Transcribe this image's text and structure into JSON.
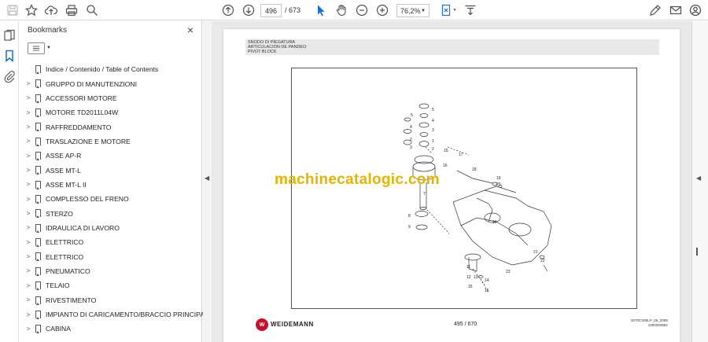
{
  "toolbar": {
    "current_page": "496",
    "total_pages": "/ 673",
    "zoom": "76,2%"
  },
  "bookmarks_panel": {
    "title": "Bookmarks",
    "close": "×",
    "items": [
      {
        "label": "Indice / Contenido / Table of Contents",
        "has_children": false
      },
      {
        "label": "GRUPPO DI MANUTENZIONI",
        "has_children": true
      },
      {
        "label": "ACCESSORI MOTORE",
        "has_children": true
      },
      {
        "label": "MOTORE TD2011L04W",
        "has_children": true
      },
      {
        "label": "RAFFREDDAMENTO",
        "has_children": true
      },
      {
        "label": "TRASLAZIONE E MOTORE",
        "has_children": true
      },
      {
        "label": "ASSE AP-R",
        "has_children": true
      },
      {
        "label": "ASSE MT-L",
        "has_children": true
      },
      {
        "label": "ASSE MT-L II",
        "has_children": true
      },
      {
        "label": "COMPLESSO DEL FRENO",
        "has_children": true
      },
      {
        "label": "STERZO",
        "has_children": true
      },
      {
        "label": "IDRAULICA DI LAVORO",
        "has_children": true
      },
      {
        "label": "ELETTRICO",
        "has_children": true
      },
      {
        "label": "ELETTRICO",
        "has_children": true
      },
      {
        "label": "PNEUMATICO",
        "has_children": true
      },
      {
        "label": "TELAIO",
        "has_children": true
      },
      {
        "label": "RIVESTIMENTO",
        "has_children": true
      },
      {
        "label": "IMPIANTO DI CARICAMENTO/BRACCIO PRINCIPA",
        "has_children": true
      },
      {
        "label": "CABINA",
        "has_children": true
      }
    ]
  },
  "document": {
    "header_line1": "SNODO DI PIEGATURA",
    "header_line2": "ARTICULACION DE PANDEO",
    "header_line3": "PIVOT BLOCK",
    "watermark": "machinecatalogic.com",
    "brand": "WEIDEMANN",
    "page_number": "495 / 670",
    "doc_ref1": "3070CX80LP_06_2008",
    "doc_ref2": "1000283962",
    "part_numbers": [
      "5",
      "5",
      "4",
      "3",
      "4",
      "2",
      "1",
      "3",
      "2",
      "15",
      "17",
      "16",
      "18",
      "7",
      "6",
      "19",
      "20",
      "10",
      "8",
      "9",
      "21",
      "22",
      "11",
      "12",
      "13",
      "14",
      "15",
      "15",
      "23"
    ]
  },
  "colors": {
    "watermark": "#e5b400",
    "brand_logo": "#c8102e",
    "active_icon": "#1a6fd6"
  }
}
